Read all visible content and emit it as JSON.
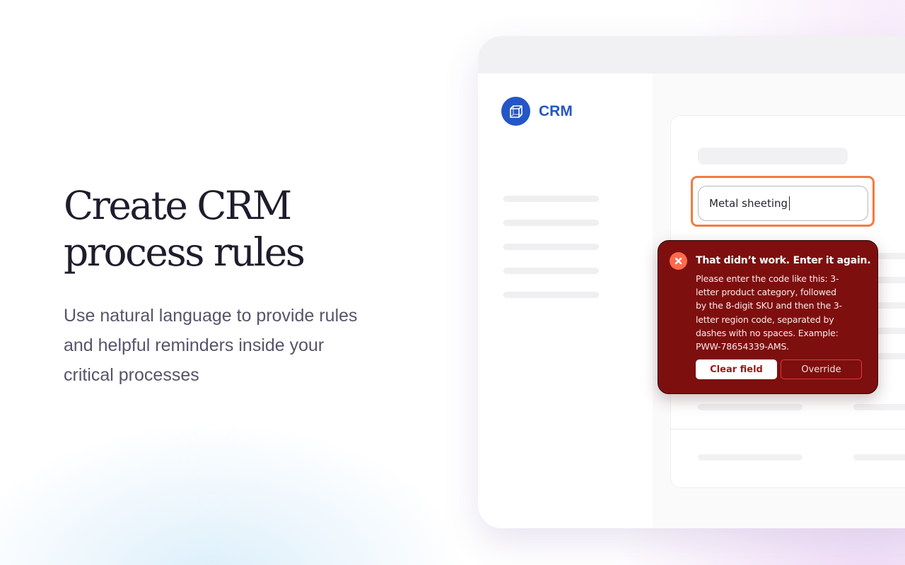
{
  "hero": {
    "title_lines": [
      "Create CRM",
      "process rules"
    ],
    "subtitle_lines": [
      "Use natural language to provide rules",
      "and helpful reminders inside your",
      "critical processes"
    ]
  },
  "app": {
    "brand_name": "CRM",
    "brand_icon": "cube-icon",
    "field": {
      "value": "Metal sheeting"
    },
    "error": {
      "icon": "close-icon",
      "title": "That didn’t work. Enter it again.",
      "message_lines": [
        "Please enter the code like this: 3-",
        "letter product category, followed",
        "by the 8-digit SKU and then the 3-",
        "letter region code, separated by",
        "dashes with no spaces. Example:",
        "PWW-78654339-AMS."
      ],
      "clear_label": "Clear field",
      "override_label": "Override"
    },
    "colors": {
      "brand": "#2456c6",
      "highlight": "#f47b3e",
      "error_bg": "#7e0f0f",
      "error_icon": "#ff6a4d"
    }
  }
}
